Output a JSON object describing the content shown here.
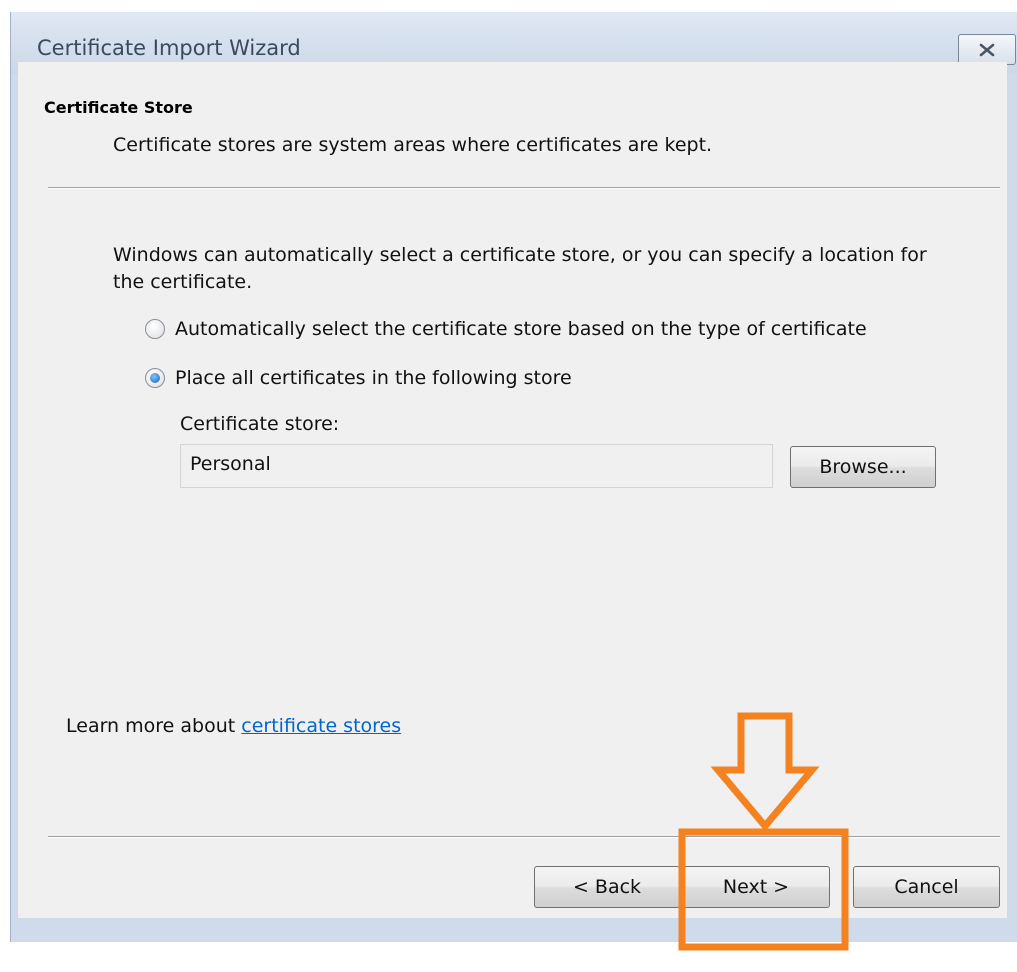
{
  "window": {
    "title": "Certificate Import Wizard",
    "close_icon": "close-x-icon"
  },
  "header": {
    "title": "Certificate Store",
    "subtitle": "Certificate stores are system areas where certificates are kept."
  },
  "body": {
    "intro": "Windows can automatically select a certificate store, or you can specify a location for the certificate.",
    "options": [
      {
        "label": "Automatically select the certificate store based on the type of certificate",
        "checked": false
      },
      {
        "label": "Place all certificates in the following store",
        "checked": true
      }
    ],
    "store_label": "Certificate store:",
    "store_value": "Personal",
    "browse_label": "Browse..."
  },
  "learn_more": {
    "prefix": "Learn more about ",
    "link": "certificate stores"
  },
  "footer": {
    "back_label": "< Back",
    "next_label": "Next >",
    "cancel_label": "Cancel"
  },
  "annotation": {
    "color": "#f58220",
    "icon": "down-arrow-highlight"
  }
}
